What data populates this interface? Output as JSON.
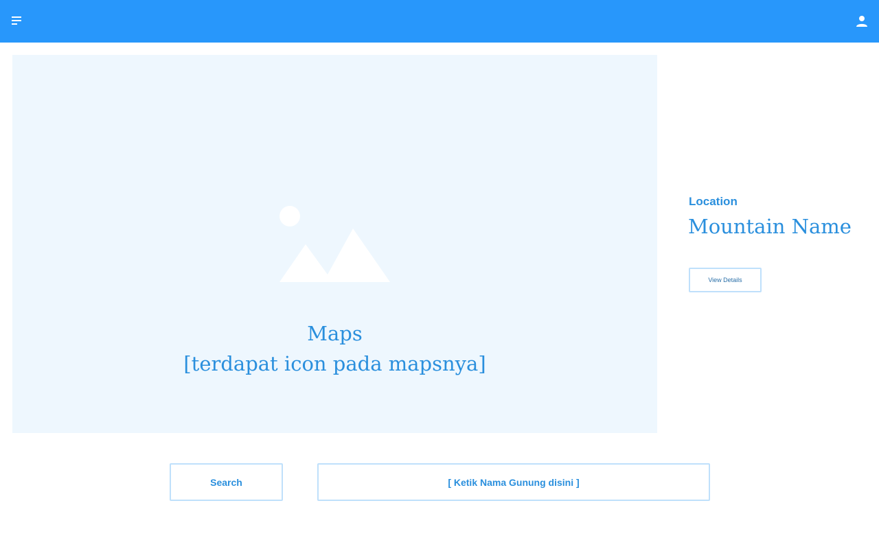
{
  "header": {
    "background_color": "#2897fb",
    "menu_icon": "menu-lines-icon",
    "user_icon": "user-icon"
  },
  "map": {
    "placeholder_icon": "image-placeholder-icon",
    "caption_line1": "Maps",
    "caption_line2": "[terdapat icon pada mapsnya]",
    "background_color": "#eef7fe"
  },
  "detail_panel": {
    "location_label": "Location",
    "mountain_name": "Mountain Name",
    "view_details_label": "View Details"
  },
  "search": {
    "button_label": "Search",
    "input_placeholder": "[ Ketik Nama Gunung disini ]"
  },
  "colors": {
    "accent": "#2a8fdd",
    "border": "#bfe0fb"
  }
}
